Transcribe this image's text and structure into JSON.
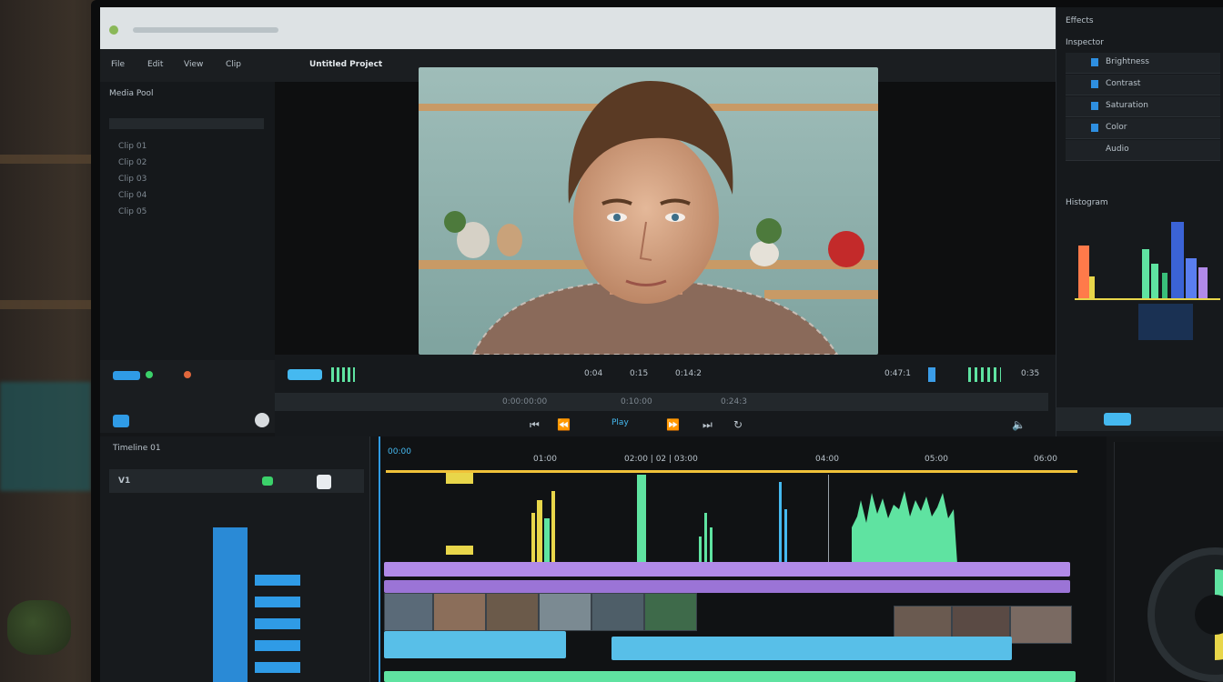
{
  "menu": {
    "project_title": "Untitled Project",
    "items": [
      "File",
      "Edit",
      "View",
      "Clip"
    ]
  },
  "viewer": {
    "timecode_a": "0:04",
    "timecode_b": "0:15",
    "timecode_c": "0:14:2",
    "timecode_right": "0:47:1",
    "timecode_far": "0:35"
  },
  "transport": {
    "scrub_left": "0:00:00:00",
    "scrub_mid": "0:10:00",
    "scrub_right": "0:24:3",
    "play_label": "Play"
  },
  "right_panel": {
    "title": "Effects",
    "section": "Inspector",
    "items": [
      "Brightness",
      "Contrast",
      "Saturation",
      "Color",
      "Audio"
    ],
    "scope_label": "Histogram"
  },
  "timeline": {
    "header_label": "Timeline 01",
    "markers": [
      "00:00",
      "01:00",
      "02:00 | 02 | 03:00",
      "04:00",
      "05:00",
      "06:00"
    ],
    "track_label": "V1"
  },
  "left_panel": {
    "media_label": "Media Pool",
    "rows": [
      "Clip 01",
      "Clip 02",
      "Clip 03",
      "Clip 04",
      "Clip 05"
    ]
  },
  "colors": {
    "accent_blue": "#2f9be6",
    "audio_green": "#5fe3a1",
    "audio_yellow": "#e8d64a",
    "clip_purple": "#b18ae8",
    "clip_cyan": "#58bfe8",
    "playhead": "#f0c23a"
  },
  "icons": [
    "play-icon",
    "pause-icon",
    "scissor-icon",
    "magnet-icon",
    "speaker-icon",
    "settings-icon"
  ]
}
